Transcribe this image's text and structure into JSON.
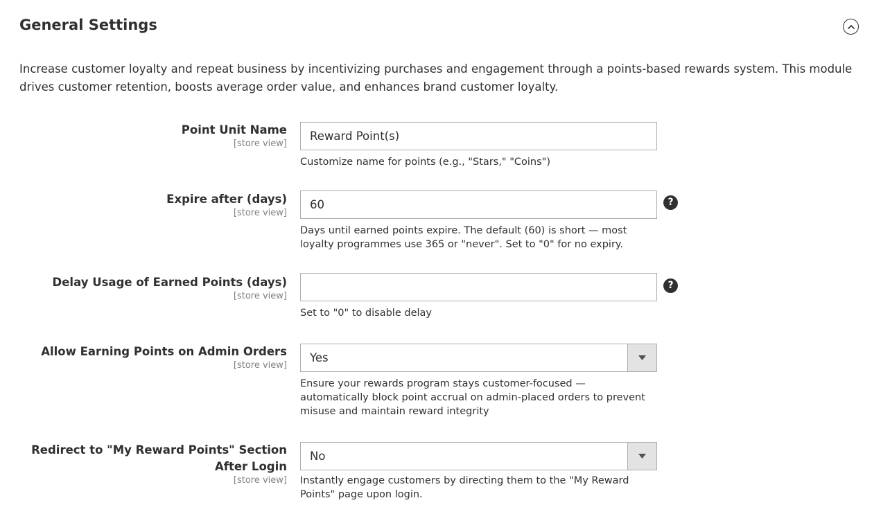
{
  "section": {
    "title": "General Settings",
    "intro": "Increase customer loyalty and repeat business by incentivizing purchases and engagement through a points-based rewards system. This module drives customer retention, boosts average order value, and enhances brand customer loyalty."
  },
  "fields": {
    "point_unit_name": {
      "label": "Point Unit Name",
      "scope": "[store view]",
      "value": "Reward Point(s)",
      "note": "Customize name for points (e.g., \"Stars,\" \"Coins\")"
    },
    "expire_after": {
      "label": "Expire after (days)",
      "scope": "[store view]",
      "value": "60",
      "note": "Days until earned points expire. The default (60) is short — most loyalty programmes use 365 or \"never\". Set to \"0\" for no expiry.",
      "help": "?"
    },
    "delay_usage": {
      "label": "Delay Usage of Earned Points (days)",
      "scope": "[store view]",
      "value": "",
      "note": "Set to \"0\" to disable delay",
      "help": "?"
    },
    "allow_admin_orders": {
      "label": "Allow Earning Points on Admin Orders",
      "scope": "[store view]",
      "value": "Yes",
      "note": "Ensure your rewards program stays customer-focused — automatically block point accrual on admin-placed orders to prevent misuse and maintain reward integrity"
    },
    "redirect_after_login": {
      "label": "Redirect to \"My Reward Points\" Section After Login",
      "scope": "[store view]",
      "value": "No",
      "note": "Instantly engage customers by directing them to the \"My Reward Points\" page upon login."
    }
  },
  "icons": {
    "collapse": "chevron-up-circle-icon",
    "help": "question-circle-icon",
    "dropdown": "triangle-down-icon"
  },
  "colors": {
    "text": "#303030",
    "scope": "#808080",
    "border": "#adadad",
    "select_arrow_bg": "#e3e3e3"
  }
}
